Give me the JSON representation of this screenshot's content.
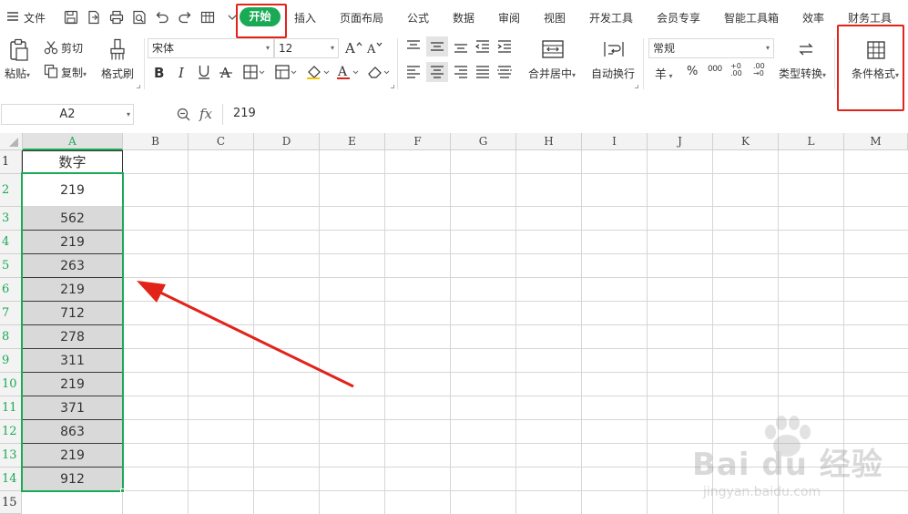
{
  "menubar": {
    "file_label": "文件",
    "tabs": [
      "开始",
      "插入",
      "页面布局",
      "公式",
      "数据",
      "审阅",
      "视图",
      "开发工具",
      "会员专享",
      "智能工具箱",
      "效率",
      "财务工具"
    ]
  },
  "ribbon": {
    "paste": "粘贴",
    "cut": "剪切",
    "copy": "复制",
    "format_painter": "格式刷",
    "font_name": "宋体",
    "font_size": "12",
    "merge_center": "合并居中",
    "wrap_text": "自动换行",
    "number_format": "常规",
    "type_convert": "类型转换",
    "conditional_format": "条件格式",
    "currency_symbol": "羊",
    "percent_symbol": "%",
    "thousands_symbol": "000",
    "inc_decimal": "+0 .00",
    "dec_decimal": ".00 →0"
  },
  "formula_bar": {
    "name_box": "A2",
    "fx": "fx",
    "value": "219"
  },
  "grid": {
    "columns": [
      "A",
      "B",
      "C",
      "D",
      "E",
      "F",
      "G",
      "H",
      "I",
      "J",
      "K",
      "L",
      "M"
    ],
    "rows": [
      "1",
      "2",
      "3",
      "4",
      "5",
      "6",
      "7",
      "8",
      "9",
      "10",
      "11",
      "12",
      "13",
      "14",
      "15"
    ],
    "header_cell": "数字",
    "values": [
      "219",
      "562",
      "219",
      "263",
      "219",
      "712",
      "278",
      "311",
      "219",
      "371",
      "863",
      "219",
      "912"
    ]
  },
  "watermark": {
    "brand": "Bai du 经验",
    "url": "jingyan.baidu.com"
  },
  "colors": {
    "accent_green": "#1aaa55",
    "annotation_red": "#e2231a",
    "selection_fill": "#d9d9d9"
  }
}
